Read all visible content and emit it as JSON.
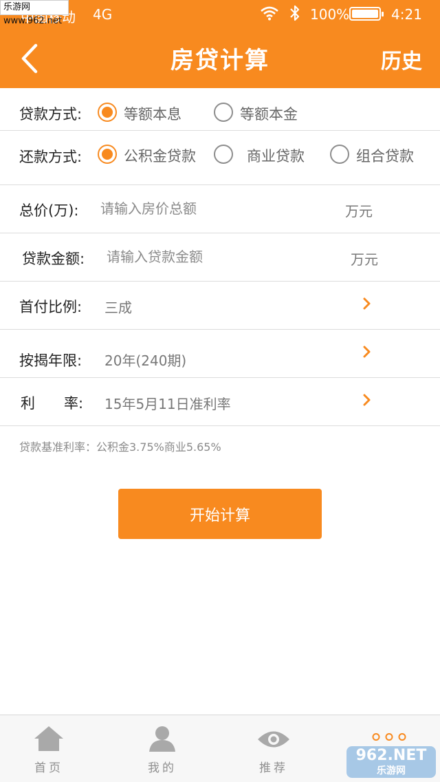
{
  "status_bar": {
    "carrier": "中国移动",
    "network": "4G",
    "battery": "100%",
    "time": "4:21"
  },
  "watermark": "乐游网 www.962.net",
  "header": {
    "title": "房贷计算",
    "history_label": "历史",
    "back_icon": "chevron-left-icon"
  },
  "loan_method": {
    "label": "贷款方式:",
    "options": [
      "等额本息",
      "等额本金"
    ],
    "selected": "等额本息"
  },
  "repay_method": {
    "label": "还款方式:",
    "options": [
      "公积金贷款",
      "商业贷款",
      "组合贷款"
    ],
    "selected": "公积金贷款"
  },
  "form": {
    "total_price": {
      "label": "总价(万):",
      "placeholder": "请输入房价总额",
      "unit": "万元"
    },
    "loan_amount": {
      "label": "贷款金额:",
      "placeholder": "请输入贷款金额",
      "unit": "万元"
    },
    "down_payment": {
      "label": "首付比例:",
      "value": "三成"
    },
    "mortgage_term": {
      "label": "按揭年限:",
      "value": "20年(240期)"
    },
    "interest_rate": {
      "label": "利　　率:",
      "value": "15年5月11日准利率"
    }
  },
  "rate_note": "贷款基准利率：公积金3.75%商业5.65%",
  "calc_button": "开始计算",
  "tabbar": {
    "tabs": [
      {
        "label": "首页",
        "icon": "home-icon"
      },
      {
        "label": "我的",
        "icon": "user-icon"
      },
      {
        "label": "推荐",
        "icon": "eye-icon"
      },
      {
        "label": "",
        "icon": "more-dots-icon"
      }
    ]
  },
  "corner_logo": {
    "main": "962.NET",
    "sub": "乐游网"
  },
  "colors": {
    "accent": "#f88a1f",
    "divider": "#dcdcdc",
    "tabbar_bg": "#f7f7f7"
  }
}
